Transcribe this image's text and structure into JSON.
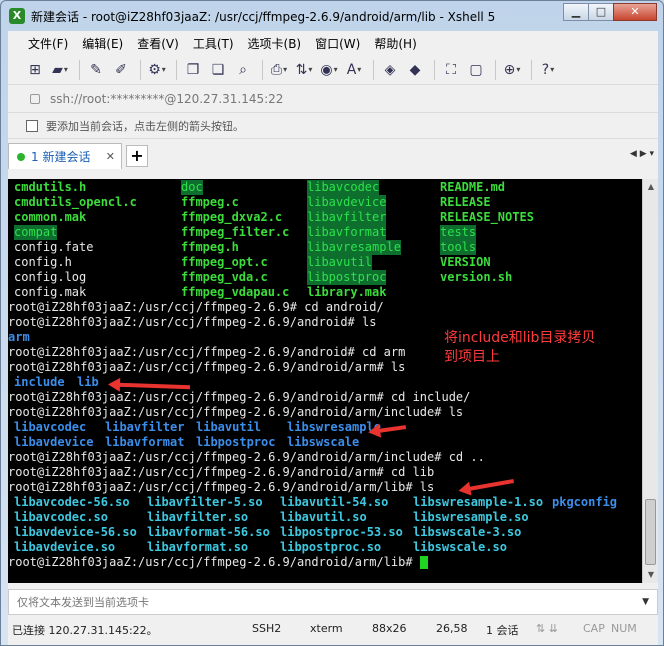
{
  "window": {
    "title": "新建会话 - root@iZ28hf03jaaZ: /usr/ccj/ffmpeg-2.6.9/android/arm/lib - Xshell 5",
    "app_icon": "xshell-logo-icon"
  },
  "menu": [
    "文件(F)",
    "编辑(E)",
    "查看(V)",
    "工具(T)",
    "选项卡(B)",
    "窗口(W)",
    "帮助(H)"
  ],
  "address": {
    "value": "ssh://root:*********@120.27.31.145:22"
  },
  "hint": {
    "text": "要添加当前会话，点击左侧的箭头按钮。"
  },
  "tabs": [
    {
      "label": "1 新建会话",
      "active": true
    }
  ],
  "terminal": {
    "listing_rows": [
      [
        "cmdutils.h",
        "doc",
        "libavcodec",
        "README.md"
      ],
      [
        "cmdutils_opencl.c",
        "ffmpeg.c",
        "libavdevice",
        "RELEASE"
      ],
      [
        "common.mak",
        "ffmpeg_dxva2.c",
        "libavfilter",
        "RELEASE_NOTES"
      ],
      [
        "compat",
        "ffmpeg_filter.c",
        "libavformat",
        "tests"
      ],
      [
        "config.fate",
        "ffmpeg.h",
        "libavresample",
        "tools"
      ],
      [
        "config.h",
        "ffmpeg_opt.c",
        "libavutil",
        "VERSION"
      ],
      [
        "config.log",
        "ffmpeg_vda.c",
        "libpostproc",
        "version.sh"
      ],
      [
        "config.mak",
        "ffmpeg_vdapau.c",
        "library.mak",
        ""
      ]
    ],
    "lines": {
      "l9": "root@iZ28hf03jaaZ:/usr/ccj/ffmpeg-2.6.9# cd android/",
      "l10": "root@iZ28hf03jaaZ:/usr/ccj/ffmpeg-2.6.9/android# ls",
      "l11": "arm",
      "l12": "root@iZ28hf03jaaZ:/usr/ccj/ffmpeg-2.6.9/android# cd arm",
      "l13": "root@iZ28hf03jaaZ:/usr/ccj/ffmpeg-2.6.9/android/arm# ls",
      "l14a": "include",
      "l14b": "lib",
      "l15": "root@iZ28hf03jaaZ:/usr/ccj/ffmpeg-2.6.9/android/arm# cd include/",
      "l16": "root@iZ28hf03jaaZ:/usr/ccj/ffmpeg-2.6.9/android/arm/include# ls",
      "l17": [
        "libavcodec",
        "libavfilter",
        "libavutil",
        "libswresample"
      ],
      "l18": [
        "libavdevice",
        "libavformat",
        "libpostproc",
        "libswscale"
      ],
      "l19": "root@iZ28hf03jaaZ:/usr/ccj/ffmpeg-2.6.9/android/arm/include# cd ..",
      "l20": "root@iZ28hf03jaaZ:/usr/ccj/ffmpeg-2.6.9/android/arm# cd lib",
      "l21": "root@iZ28hf03jaaZ:/usr/ccj/ffmpeg-2.6.9/android/arm/lib# ls",
      "l22": [
        "libavcodec-56.so",
        "libavfilter-5.so",
        "libavutil-54.so",
        "libswresample-1.so",
        "pkgconfig"
      ],
      "l23": [
        "libavcodec.so",
        "libavfilter.so",
        "libavutil.so",
        "libswresample.so"
      ],
      "l24": [
        "libavdevice-56.so",
        "libavformat-56.so",
        "libpostproc-53.so",
        "libswscale-3.so"
      ],
      "l25": [
        "libavdevice.so",
        "libavformat.so",
        "libpostproc.so",
        "libswscale.so"
      ],
      "l26": "root@iZ28hf03jaaZ:/usr/ccj/ffmpeg-2.6.9/android/arm/lib# "
    }
  },
  "annotation": {
    "line1": "将include和lib目录拷贝",
    "line2": "到项目上"
  },
  "sendbar": {
    "placeholder": "仅将文本发送到当前选项卡"
  },
  "status": {
    "connection": "已连接 120.27.31.145:22。",
    "protocol": "SSH2",
    "term": "xterm",
    "size": "88x26",
    "position": "26,58",
    "sessions": "1 会话",
    "caps": "CAP",
    "num": "NUM"
  }
}
